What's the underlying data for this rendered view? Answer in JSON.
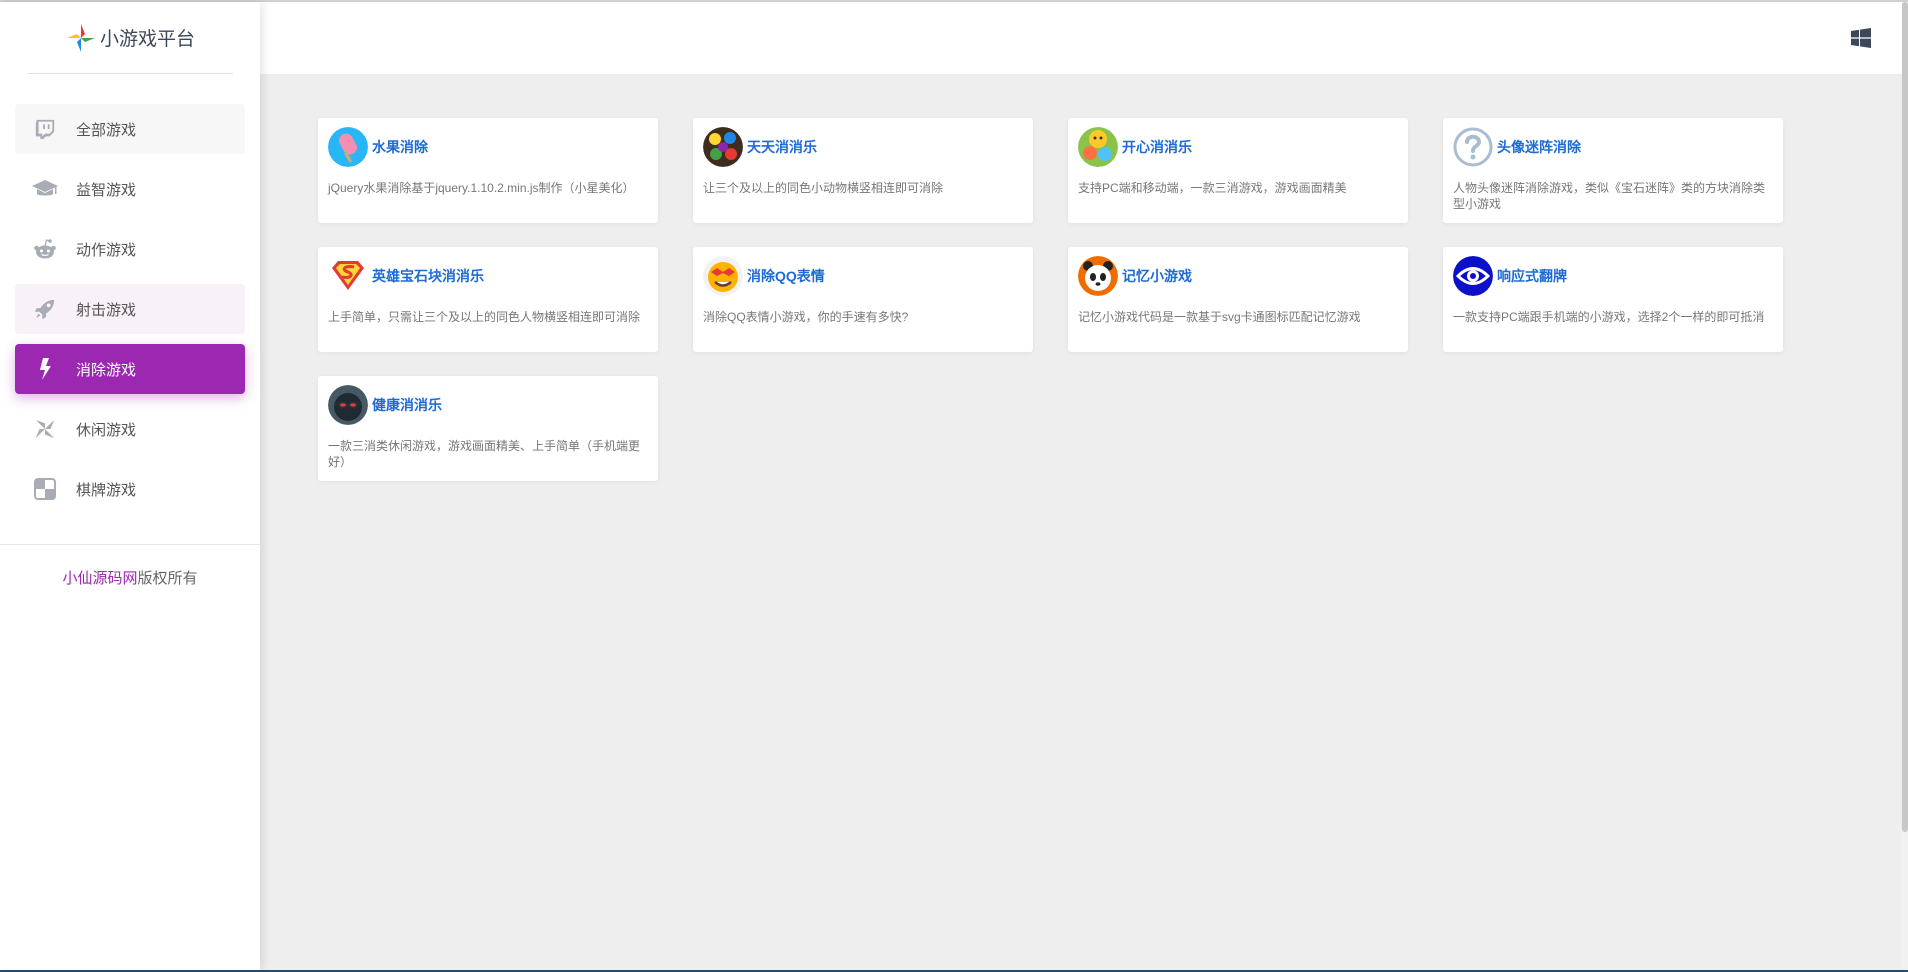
{
  "brand": {
    "title": "小游戏平台"
  },
  "sidebar": {
    "items": [
      {
        "label": "全部游戏",
        "icon": "twitch-icon"
      },
      {
        "label": "益智游戏",
        "icon": "graduation-cap-icon"
      },
      {
        "label": "动作游戏",
        "icon": "reddit-icon"
      },
      {
        "label": "射击游戏",
        "icon": "rocket-icon"
      },
      {
        "label": "消除游戏",
        "icon": "hubspot-icon"
      },
      {
        "label": "休闲游戏",
        "icon": "pinwheel-icon"
      },
      {
        "label": "棋牌游戏",
        "icon": "chess-board-icon"
      }
    ],
    "active_index": 4
  },
  "footer": {
    "site": "小仙源码网",
    "rights": "版权所有"
  },
  "header": {
    "icon": "windows-icon"
  },
  "colors": {
    "accent": "#9c27b0",
    "link": "#1e6bd6"
  },
  "games": [
    {
      "title": "水果消除",
      "desc": "jQuery水果消除基于jquery.1.10.2.min.js制作（小星美化）",
      "thumb": "popsicle-thumb"
    },
    {
      "title": "天天消消乐",
      "desc": "让三个及以上的同色小动物横竖相连即可消除",
      "thumb": "animals-thumb"
    },
    {
      "title": "开心消消乐",
      "desc": "支持PC端和移动端，一款三消游戏，游戏画面精美",
      "thumb": "happy-game-thumb"
    },
    {
      "title": "头像迷阵消除",
      "desc": "人物头像迷阵消除游戏，类似《宝石迷阵》类的方块消除类型小游戏",
      "thumb": "question-thumb"
    },
    {
      "title": "英雄宝石块消消乐",
      "desc": "上手简单，只需让三个及以上的同色人物横竖相连即可消除",
      "thumb": "superman-thumb"
    },
    {
      "title": "消除QQ表情",
      "desc": "消除QQ表情小游戏，你的手速有多快?",
      "thumb": "emoji-thumb"
    },
    {
      "title": "记忆小游戏",
      "desc": "记忆小游戏代码是一款基于svg卡通图标匹配记忆游戏",
      "thumb": "panda-thumb"
    },
    {
      "title": "响应式翻牌",
      "desc": "一款支持PC端跟手机端的小游戏，选择2个一样的即可抵消",
      "thumb": "eye-thumb"
    },
    {
      "title": "健康消消乐",
      "desc": "一款三消类休闲游戏，游戏画面精美、上手简单（手机端更好）",
      "thumb": "masked-hero-thumb"
    }
  ]
}
